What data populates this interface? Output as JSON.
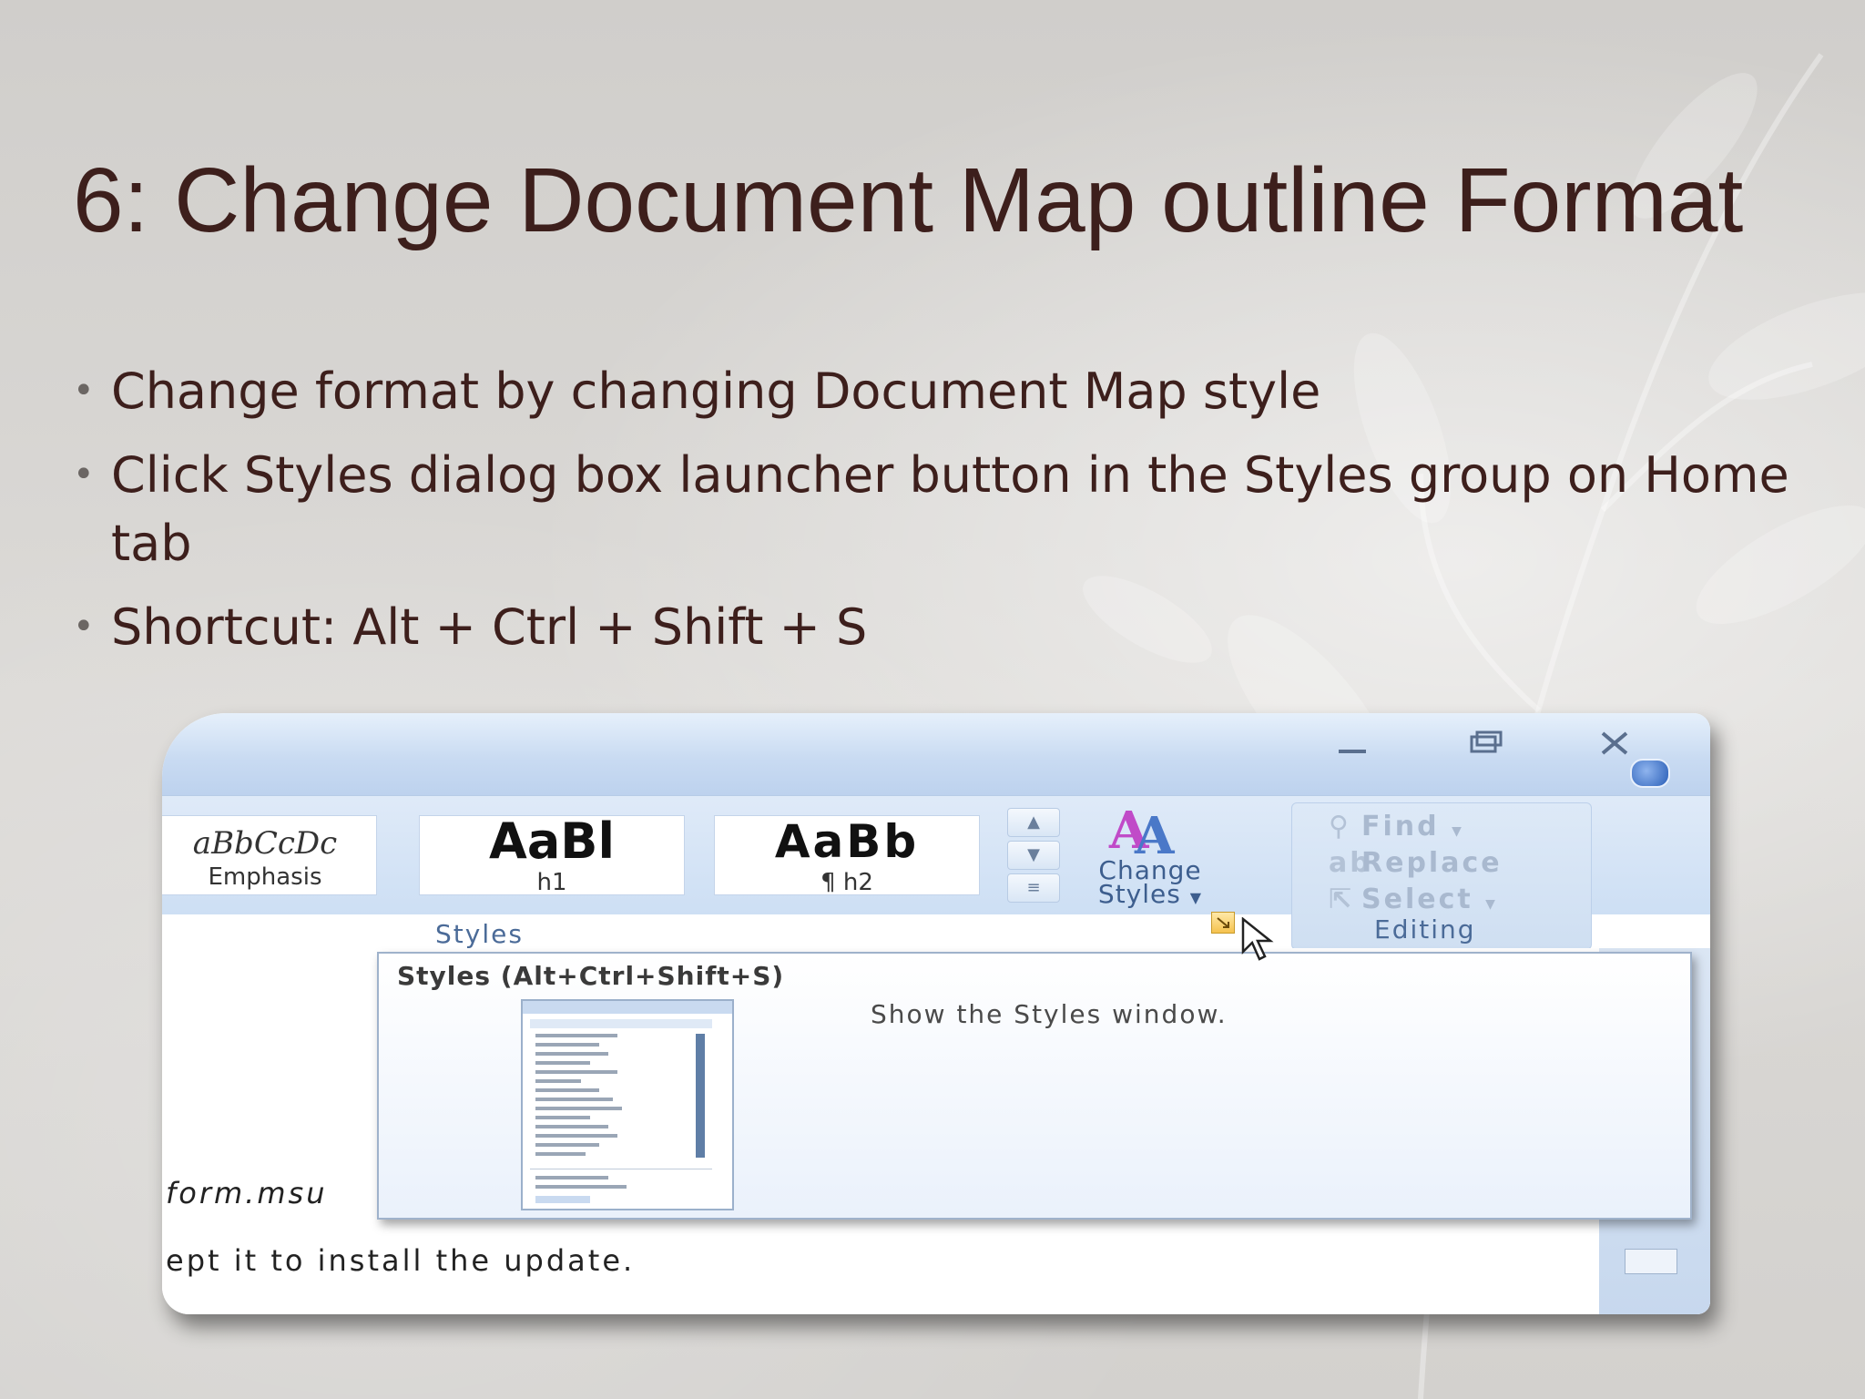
{
  "slide": {
    "title": "6: Change Document Map outline Format",
    "bullets": [
      "Change format by changing Document Map style",
      "Click Styles dialog box launcher button in the Styles group on Home tab",
      "Shortcut: Alt + Ctrl + Shift + S"
    ]
  },
  "screenshot": {
    "ribbon": {
      "styles_gallery": [
        {
          "sample": "aBbCcDc",
          "name": "Emphasis"
        },
        {
          "sample": "AaBl",
          "name": "h1"
        },
        {
          "sample": "AaBb",
          "name": "¶ h2"
        }
      ],
      "change_styles_label_1": "Change",
      "change_styles_label_2": "Styles",
      "styles_group_label": "Styles",
      "editing": {
        "find": "Find",
        "replace": "Replace",
        "select": "Select",
        "group_label": "Editing"
      }
    },
    "tooltip": {
      "title": "Styles (Alt+Ctrl+Shift+S)",
      "description": "Show the Styles window."
    },
    "document": {
      "line1": "form.msu",
      "line2": "ept it to install the update."
    },
    "colors": {
      "title_text": "#3d1f1c",
      "ribbon_blue": "#cddff4",
      "group_label": "#4b6b98"
    }
  }
}
